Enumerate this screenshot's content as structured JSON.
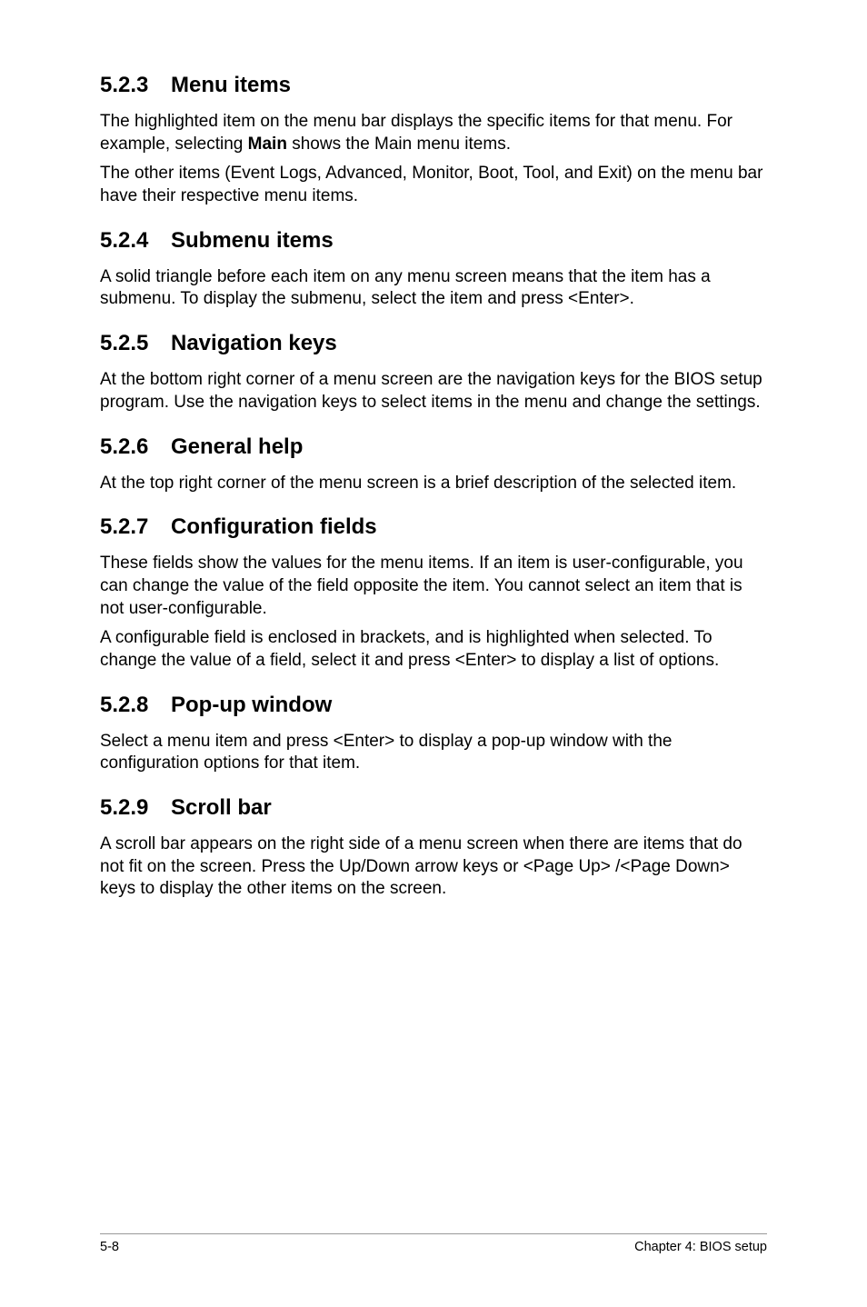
{
  "sections": {
    "s523": {
      "number": "5.2.3",
      "title": "Menu items",
      "p1_a": "The highlighted item on the menu bar displays the specific items for that menu. For example, selecting ",
      "p1_b": "Main",
      "p1_c": " shows the Main menu items.",
      "p2": "The other items (Event Logs, Advanced, Monitor, Boot, Tool, and Exit) on the menu bar have their respective menu items."
    },
    "s524": {
      "number": "5.2.4",
      "title": "Submenu items",
      "p1": "A solid triangle before each item on any menu screen means that the item has a submenu. To display the submenu, select the item and press <Enter>."
    },
    "s525": {
      "number": "5.2.5",
      "title": "Navigation keys",
      "p1": "At the bottom right corner of a menu screen are the navigation keys for the BIOS setup program. Use the navigation keys to select items in the menu and change the settings."
    },
    "s526": {
      "number": "5.2.6",
      "title": "General help",
      "p1": "At the top right corner of the menu screen is a brief description of the selected item."
    },
    "s527": {
      "number": "5.2.7",
      "title": "Configuration fields",
      "p1": "These fields show the values for the menu items. If an item is user-configurable, you can change the value of the field opposite the item. You cannot select an item that is not user-configurable.",
      "p2": "A configurable field is enclosed in brackets, and is highlighted when selected. To change the value of a field, select it and press <Enter> to display a list of options."
    },
    "s528": {
      "number": "5.2.8",
      "title": "Pop-up window",
      "p1": "Select a menu item and press <Enter> to display a pop-up window with the configuration options for that item."
    },
    "s529": {
      "number": "5.2.9",
      "title": "Scroll bar",
      "p1": "A scroll bar appears on the right side of a menu screen when there are items that do not fit on the screen. Press the Up/Down arrow keys or <Page Up> /<Page Down> keys to display the other items on the screen."
    }
  },
  "footer": {
    "left": "5-8",
    "right": "Chapter 4: BIOS setup"
  }
}
